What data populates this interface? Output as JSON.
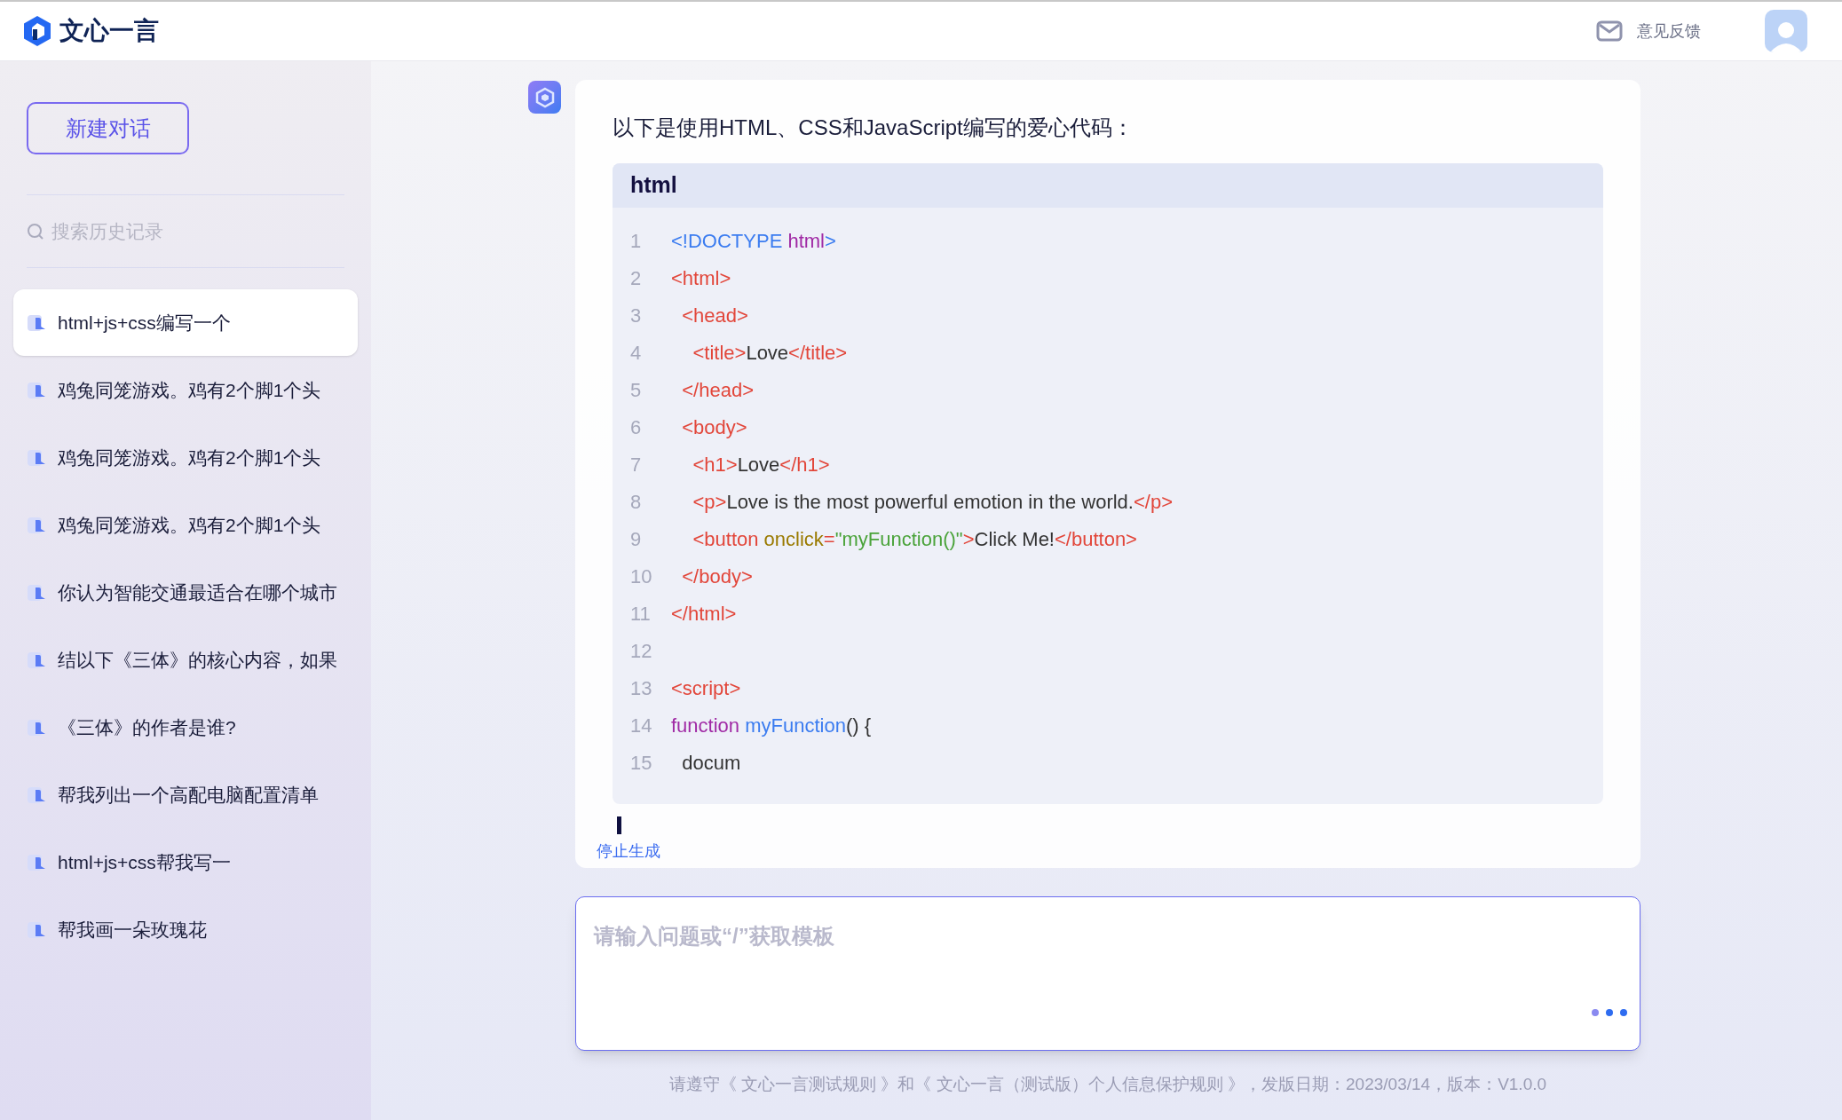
{
  "header": {
    "logo_text": "文心一言",
    "feedback": "意见反馈"
  },
  "sidebar": {
    "new_chat": "新建对话",
    "search": {
      "placeholder": "搜索历史记录"
    },
    "items": [
      {
        "label": "html+js+css编写一个",
        "selected": true
      },
      {
        "label": "鸡兔同笼游戏。鸡有2个脚1个头",
        "selected": false
      },
      {
        "label": "鸡兔同笼游戏。鸡有2个脚1个头",
        "selected": false
      },
      {
        "label": "鸡兔同笼游戏。鸡有2个脚1个头",
        "selected": false
      },
      {
        "label": "你认为智能交通最适合在哪个城市",
        "selected": false
      },
      {
        "label": "结以下《三体》的核心内容，如果",
        "selected": false
      },
      {
        "label": "《三体》的作者是谁?",
        "selected": false
      },
      {
        "label": "帮我列出一个高配电脑配置清单",
        "selected": false
      },
      {
        "label": "html+js+css帮我写一",
        "selected": false
      },
      {
        "label": "帮我画一朵玫瑰花",
        "selected": false
      }
    ]
  },
  "answer": {
    "intro": "以下是使用HTML、CSS和JavaScript编写的爱心代码：",
    "code": {
      "language": "html",
      "lines": [
        {
          "number": "1",
          "tokens": [
            {
              "kind": "decl",
              "text": "<!DOCTYPE "
            },
            {
              "kind": "keyword",
              "text": "html"
            },
            {
              "kind": "decl",
              "text": ">"
            }
          ]
        },
        {
          "number": "2",
          "tokens": [
            {
              "kind": "tag",
              "text": "<html>"
            }
          ]
        },
        {
          "number": "3",
          "tokens": [
            {
              "kind": "tag",
              "text": "  <head>"
            }
          ]
        },
        {
          "number": "4",
          "tokens": [
            {
              "kind": "tag",
              "text": "    <title>"
            },
            {
              "kind": "text",
              "text": "Love"
            },
            {
              "kind": "tag",
              "text": "</title>"
            }
          ]
        },
        {
          "number": "5",
          "tokens": [
            {
              "kind": "tag",
              "text": "  </head>"
            }
          ]
        },
        {
          "number": "6",
          "tokens": [
            {
              "kind": "tag",
              "text": "  <body>"
            }
          ]
        },
        {
          "number": "7",
          "tokens": [
            {
              "kind": "tag",
              "text": "    <h1>"
            },
            {
              "kind": "text",
              "text": "Love"
            },
            {
              "kind": "tag",
              "text": "</h1>"
            }
          ]
        },
        {
          "number": "8",
          "tokens": [
            {
              "kind": "tag",
              "text": "    <p>"
            },
            {
              "kind": "text",
              "text": "Love is the most powerful emotion in the world."
            },
            {
              "kind": "tag",
              "text": "</p>"
            }
          ]
        },
        {
          "number": "9",
          "tokens": [
            {
              "kind": "tag",
              "text": "    <button "
            },
            {
              "kind": "attr",
              "text": "onclick"
            },
            {
              "kind": "tag",
              "text": "="
            },
            {
              "kind": "string",
              "text": "\"myFunction()\""
            },
            {
              "kind": "tag",
              "text": ">"
            },
            {
              "kind": "text",
              "text": "Click Me!"
            },
            {
              "kind": "tag",
              "text": "</button>"
            }
          ]
        },
        {
          "number": "10",
          "tokens": [
            {
              "kind": "tag",
              "text": "  </body>"
            }
          ]
        },
        {
          "number": "11",
          "tokens": [
            {
              "kind": "tag",
              "text": "</html>"
            }
          ]
        },
        {
          "number": "12"
        },
        {
          "number": "13",
          "tokens": [
            {
              "kind": "tag",
              "text": "<script>"
            }
          ]
        },
        {
          "number": "14",
          "tokens": [
            {
              "kind": "keyword",
              "text": "function "
            },
            {
              "kind": "function",
              "text": "myFunction"
            },
            {
              "kind": "text",
              "text": "() {"
            }
          ]
        },
        {
          "number": "15",
          "tokens": [
            {
              "kind": "text",
              "text": "  docum"
            }
          ]
        }
      ]
    },
    "stop": "停止生成"
  },
  "input": {
    "placeholder": "请输入问题或“/”获取模板"
  },
  "footer": "请遵守《 文心一言测试规则 》和《 文心一言（测试版）个人信息保护规则 》，发版日期：2023/03/14，版本：V1.0.0"
}
